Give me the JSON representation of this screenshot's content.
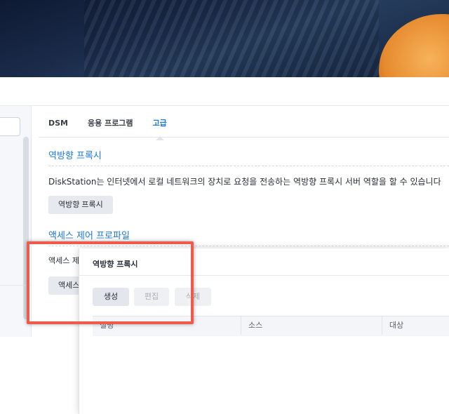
{
  "tabs": [
    {
      "label": "DSM"
    },
    {
      "label": "응용 프로그램"
    },
    {
      "label": "고급"
    }
  ],
  "reverse_proxy": {
    "title": "역방향 프록시",
    "description": "DiskStation는 인터넷에서 로컬 네트워크의 장치로 요청을 전송하는 역방향 프록시 서버 역할을 할 수 있습니다",
    "button": "역방향 프록시"
  },
  "access_control": {
    "title": "액세스 제어 프로파일",
    "label": "액세스 제",
    "button": "액세스"
  },
  "dialog": {
    "title": "역방향 프록시",
    "buttons": {
      "create": "생성",
      "edit": "편집",
      "delete": "삭제"
    },
    "columns": [
      "설명",
      "소스",
      "대상"
    ]
  },
  "colors": {
    "accent": "#1c78d0",
    "highlight": "#ee5b4d"
  }
}
